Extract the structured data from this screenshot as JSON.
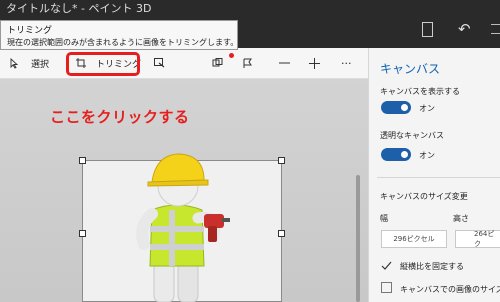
{
  "window": {
    "title": "タイトルなし* - ペイント 3D"
  },
  "tooltip": {
    "title": "トリミング",
    "description": "現在の選択範囲のみが含まれるように画像をトリミングします。"
  },
  "toolbar": {
    "select_label": "選択",
    "crop_label": "トリミング",
    "more_label": "···"
  },
  "annotation": {
    "instruction": "ここをクリックする",
    "color": "#e61e1e"
  },
  "panel": {
    "title": "キャンバス",
    "show_canvas_label": "キャンバスを表示する",
    "show_canvas_state": "オン",
    "transparent_label": "透明なキャンバス",
    "transparent_state": "オン",
    "resize_heading": "キャンバスのサイズ変更",
    "width_label": "幅",
    "height_label": "高さ",
    "width_value": "296ピクセル",
    "height_value": "264ピク",
    "lock_aspect_label": "縦横比を固定する",
    "resize_image_label": "キャンバスでの画像のサイズ変更"
  },
  "colors": {
    "accent": "#0f62b3",
    "toggle_on": "#1d5fa8"
  }
}
